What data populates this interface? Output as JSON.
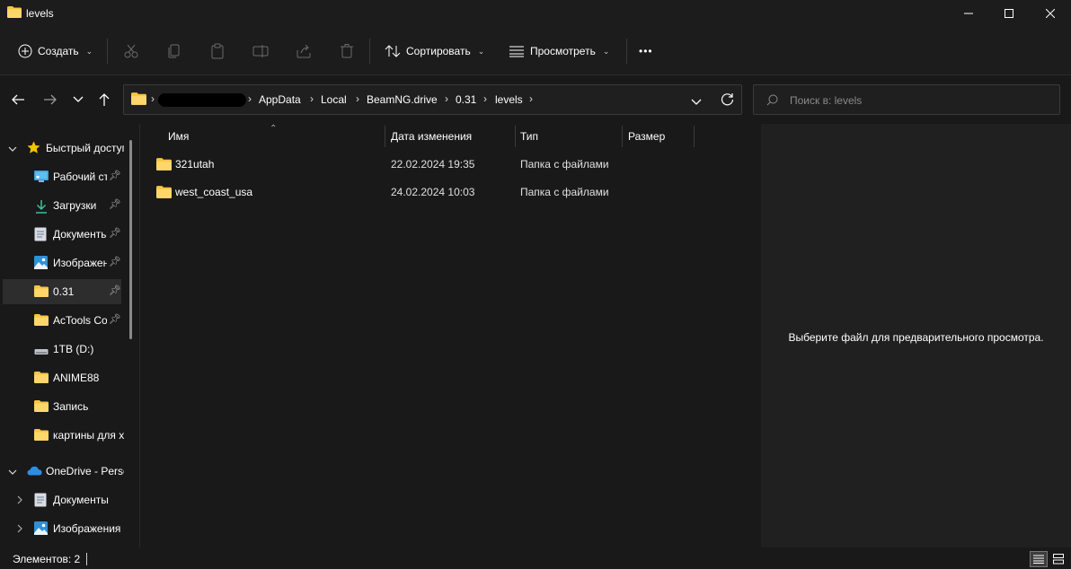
{
  "window": {
    "title": "levels"
  },
  "toolbar": {
    "create_label": "Создать",
    "sort_label": "Сортировать",
    "view_label": "Просмотреть",
    "more_label": "•••"
  },
  "address": {
    "crumbs": [
      "AppData",
      "Local",
      "BeamNG.drive",
      "0.31",
      "levels"
    ]
  },
  "search": {
    "placeholder": "Поиск в: levels"
  },
  "sidebar": {
    "items": [
      {
        "label": "Быстрый доступ",
        "icon": "star-icon",
        "pinned": false
      },
      {
        "label": "Рабочий стол",
        "icon": "desktop-icon",
        "pinned": true
      },
      {
        "label": "Загрузки",
        "icon": "download-icon",
        "pinned": true
      },
      {
        "label": "Документы",
        "icon": "document-icon",
        "pinned": true
      },
      {
        "label": "Изображения",
        "icon": "image-icon",
        "pinned": true
      },
      {
        "label": "0.31",
        "icon": "folder-icon",
        "pinned": true,
        "selected": true
      },
      {
        "label": "AcTools Content Manager",
        "icon": "folder-icon",
        "pinned": true
      },
      {
        "label": "1TB (D:)",
        "icon": "drive-icon",
        "pinned": false
      },
      {
        "label": "ANIME88",
        "icon": "folder-icon",
        "pinned": false
      },
      {
        "label": "Запись",
        "icon": "folder-icon",
        "pinned": false
      },
      {
        "label": "картины для х",
        "icon": "folder-icon",
        "pinned": false
      },
      {
        "label": "OneDrive - Personal",
        "icon": "cloud-icon",
        "pinned": false
      },
      {
        "label": "Документы",
        "icon": "document-icon",
        "pinned": false
      },
      {
        "label": "Изображения",
        "icon": "image-icon",
        "pinned": false
      }
    ]
  },
  "columns": {
    "name": "Имя",
    "modified": "Дата изменения",
    "type": "Тип",
    "size": "Размер"
  },
  "files": [
    {
      "name": "321utah",
      "modified": "22.02.2024 19:35",
      "type": "Папка с файлами",
      "size": ""
    },
    {
      "name": "west_coast_usa",
      "modified": "24.02.2024 10:03",
      "type": "Папка с файлами",
      "size": ""
    }
  ],
  "preview": {
    "message": "Выберите файл для предварительного просмотра."
  },
  "status": {
    "items_text": "Элементов: 2"
  },
  "colors": {
    "folder": "#f8c542",
    "background": "#191919",
    "preview_bg": "#202020"
  }
}
